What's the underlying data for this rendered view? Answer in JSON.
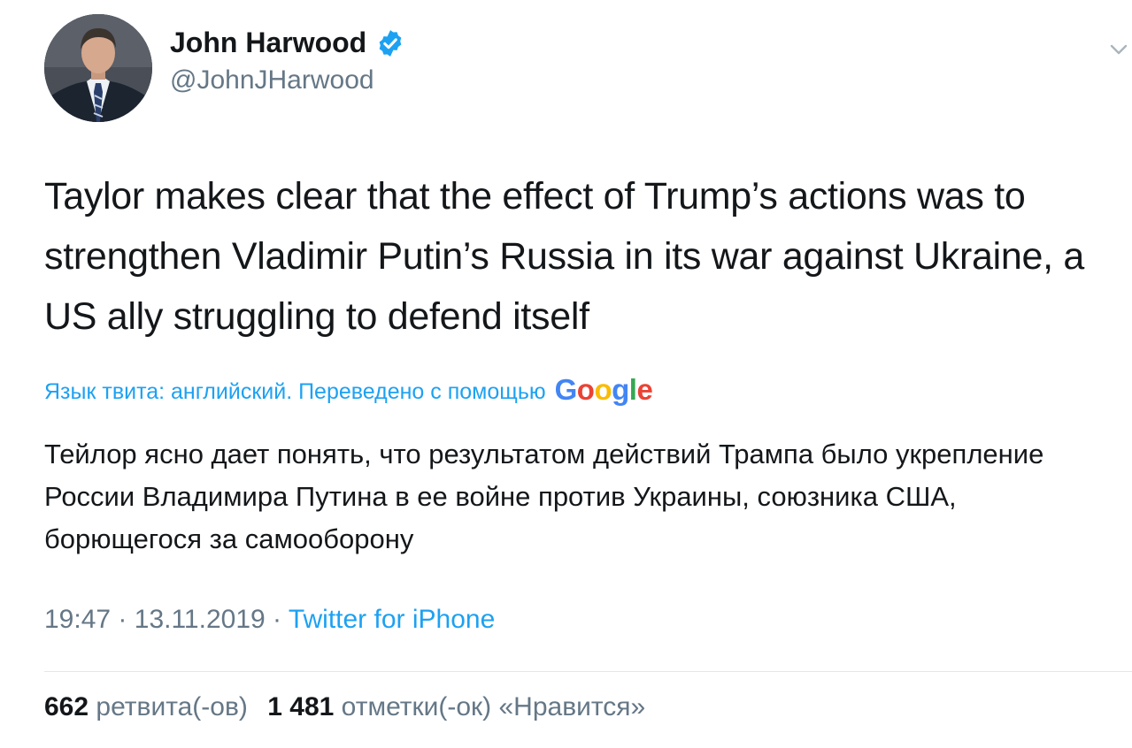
{
  "author": {
    "name": "John Harwood",
    "handle": "@JohnJHarwood",
    "verified": true
  },
  "tweet": {
    "text": "Taylor makes clear that the effect of Trump’s actions was to strengthen Vladimir Putin’s Russia in its war against Ukraine, a US ally struggling to defend itself",
    "translation_label": "Язык твита: английский. Переведено с помощью",
    "translation_provider": "Google",
    "translated_text": "Тейлор ясно дает понять, что результатом действий Трампа было укрепление России Владимира Путина в ее войне против Украины, союзника США, борющегося за самооборону"
  },
  "meta": {
    "time": "19:47",
    "separator": "·",
    "date": "13.11.2019",
    "source": "Twitter for iPhone"
  },
  "stats": {
    "retweets_count": "662",
    "retweets_label": "ретвита(-ов)",
    "likes_count": "1 481",
    "likes_label": "отметки(-ок) «Нравится»"
  },
  "icons": {
    "verified": "verified-badge-icon",
    "menu": "chevron-down-icon"
  },
  "colors": {
    "link": "#1da1f2",
    "secondary_text": "#657786",
    "primary_text": "#14171a",
    "divider": "#e1e8ed"
  }
}
